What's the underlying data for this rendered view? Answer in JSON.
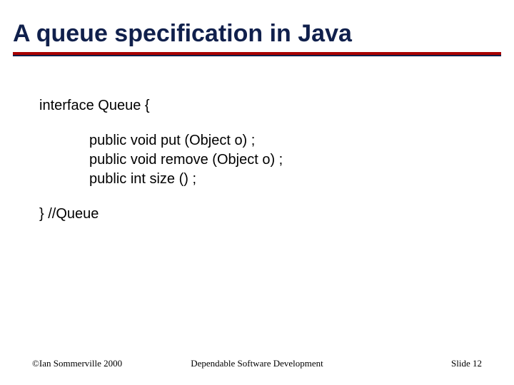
{
  "title": "A queue specification in Java",
  "code": {
    "line1": "interface Queue {",
    "m1": "public void put (Object o) ;",
    "m2": "public void remove (Object o) ;",
    "m3": "public int size () ;",
    "line2": "} //Queue"
  },
  "footer": {
    "left": "©Ian Sommerville 2000",
    "center": "Dependable Software Development",
    "right": "Slide 12"
  }
}
